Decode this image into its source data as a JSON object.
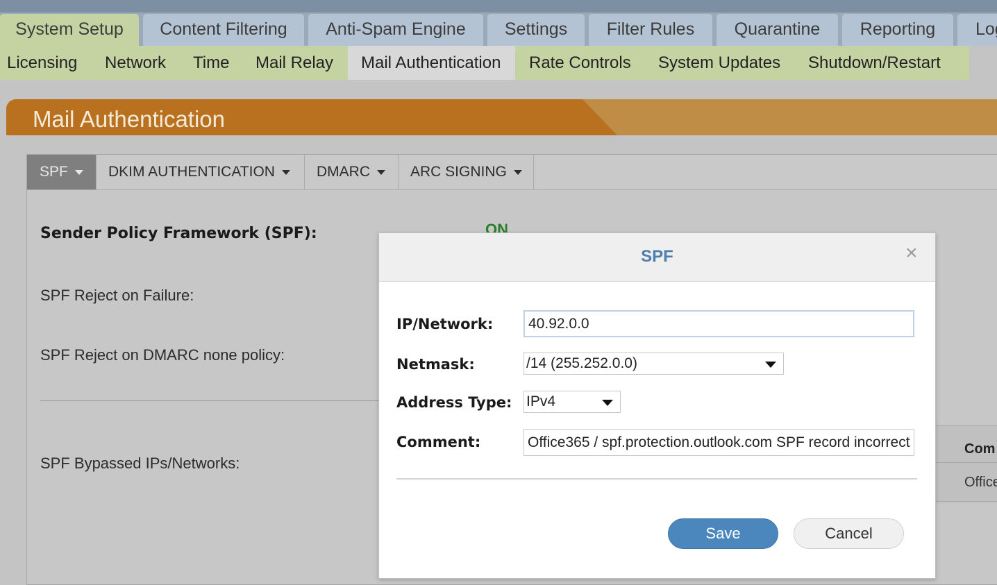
{
  "main_tabs": [
    "System Setup",
    "Content Filtering",
    "Anti-Spam Engine",
    "Settings",
    "Filter Rules",
    "Quarantine",
    "Reporting",
    "Log"
  ],
  "sub_tabs": [
    "Licensing",
    "Network",
    "Time",
    "Mail Relay",
    "Mail Authentication",
    "Rate Controls",
    "System Updates",
    "Shutdown/Restart"
  ],
  "page": {
    "title": "Mail Authentication"
  },
  "inner_tabs": [
    "SPF",
    "DKIM AUTHENTICATION",
    "DMARC",
    "ARC SIGNING"
  ],
  "spf_settings": {
    "title": "Sender Policy Framework (SPF):",
    "status": "ON",
    "reject_on_failure_label": "SPF Reject on Failure:",
    "reject_dmarc_none_label": "SPF Reject on DMARC none policy:",
    "bypassed_label": "SPF Bypassed IPs/Networks:",
    "table_header_comment": "Com",
    "table_row_comment": "Office"
  },
  "modal": {
    "title": "SPF",
    "close_symbol": "×",
    "ip_label": "IP/Network:",
    "ip_value": "40.92.0.0",
    "netmask_label": "Netmask:",
    "netmask_value": "/14 (255.252.0.0)",
    "address_type_label": "Address Type:",
    "address_type_value": "IPv4",
    "comment_label": "Comment:",
    "comment_value": "Office365 / spf.protection.outlook.com SPF record incorrect",
    "save_label": "Save",
    "cancel_label": "Cancel"
  },
  "colors": {
    "accent_orange": "#b9711f",
    "active_green": "#c5d3a3",
    "save_blue": "#4b86bd",
    "status_green": "#2a7f2a"
  }
}
